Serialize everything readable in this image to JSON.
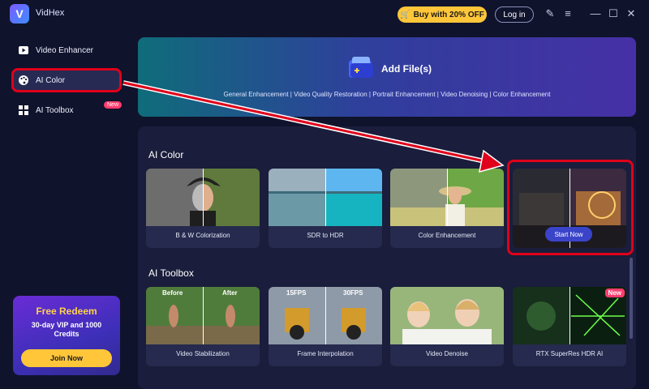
{
  "app": {
    "title": "VidHex",
    "logo_letter": "V"
  },
  "titlebar": {
    "buy_label": "Buy with 20% OFF",
    "login_label": "Log in"
  },
  "sidebar": {
    "items": [
      {
        "label": "Video Enhancer",
        "icon": "video-play-icon"
      },
      {
        "label": "AI Color",
        "icon": "palette-icon"
      },
      {
        "label": "AI Toolbox",
        "icon": "grid-icon"
      }
    ],
    "toolbox_badge": "New",
    "redeem": {
      "title": "Free Redeem",
      "subtitle": "30-day VIP and 1000 Credits",
      "button": "Join Now"
    }
  },
  "banner": {
    "title": "Add File(s)",
    "features": "General Enhancement | Video Quality Restoration | Portrait Enhancement | Video Denoising | Color Enhancement"
  },
  "sections": {
    "ai_color": {
      "title": "AI Color",
      "cards": [
        {
          "label": "B & W Colorization"
        },
        {
          "label": "SDR to HDR"
        },
        {
          "label": "Color Enhancement"
        },
        {
          "button": "Start Now"
        }
      ]
    },
    "ai_toolbox": {
      "title": "AI Toolbox",
      "cards": [
        {
          "label": "Video Stabilization",
          "left_tag": "Before",
          "right_tag": "After"
        },
        {
          "label": "Frame Interpolation",
          "left_tag": "15FPS",
          "right_tag": "30FPS"
        },
        {
          "label": "Video Denoise"
        },
        {
          "label": "RTX SuperRes HDR AI",
          "badge": "New"
        }
      ]
    }
  },
  "colors": {
    "accent_yellow": "#ffc63a",
    "highlight_red": "#e0001b",
    "panel": "#1a1d3b",
    "background": "#10132c"
  }
}
